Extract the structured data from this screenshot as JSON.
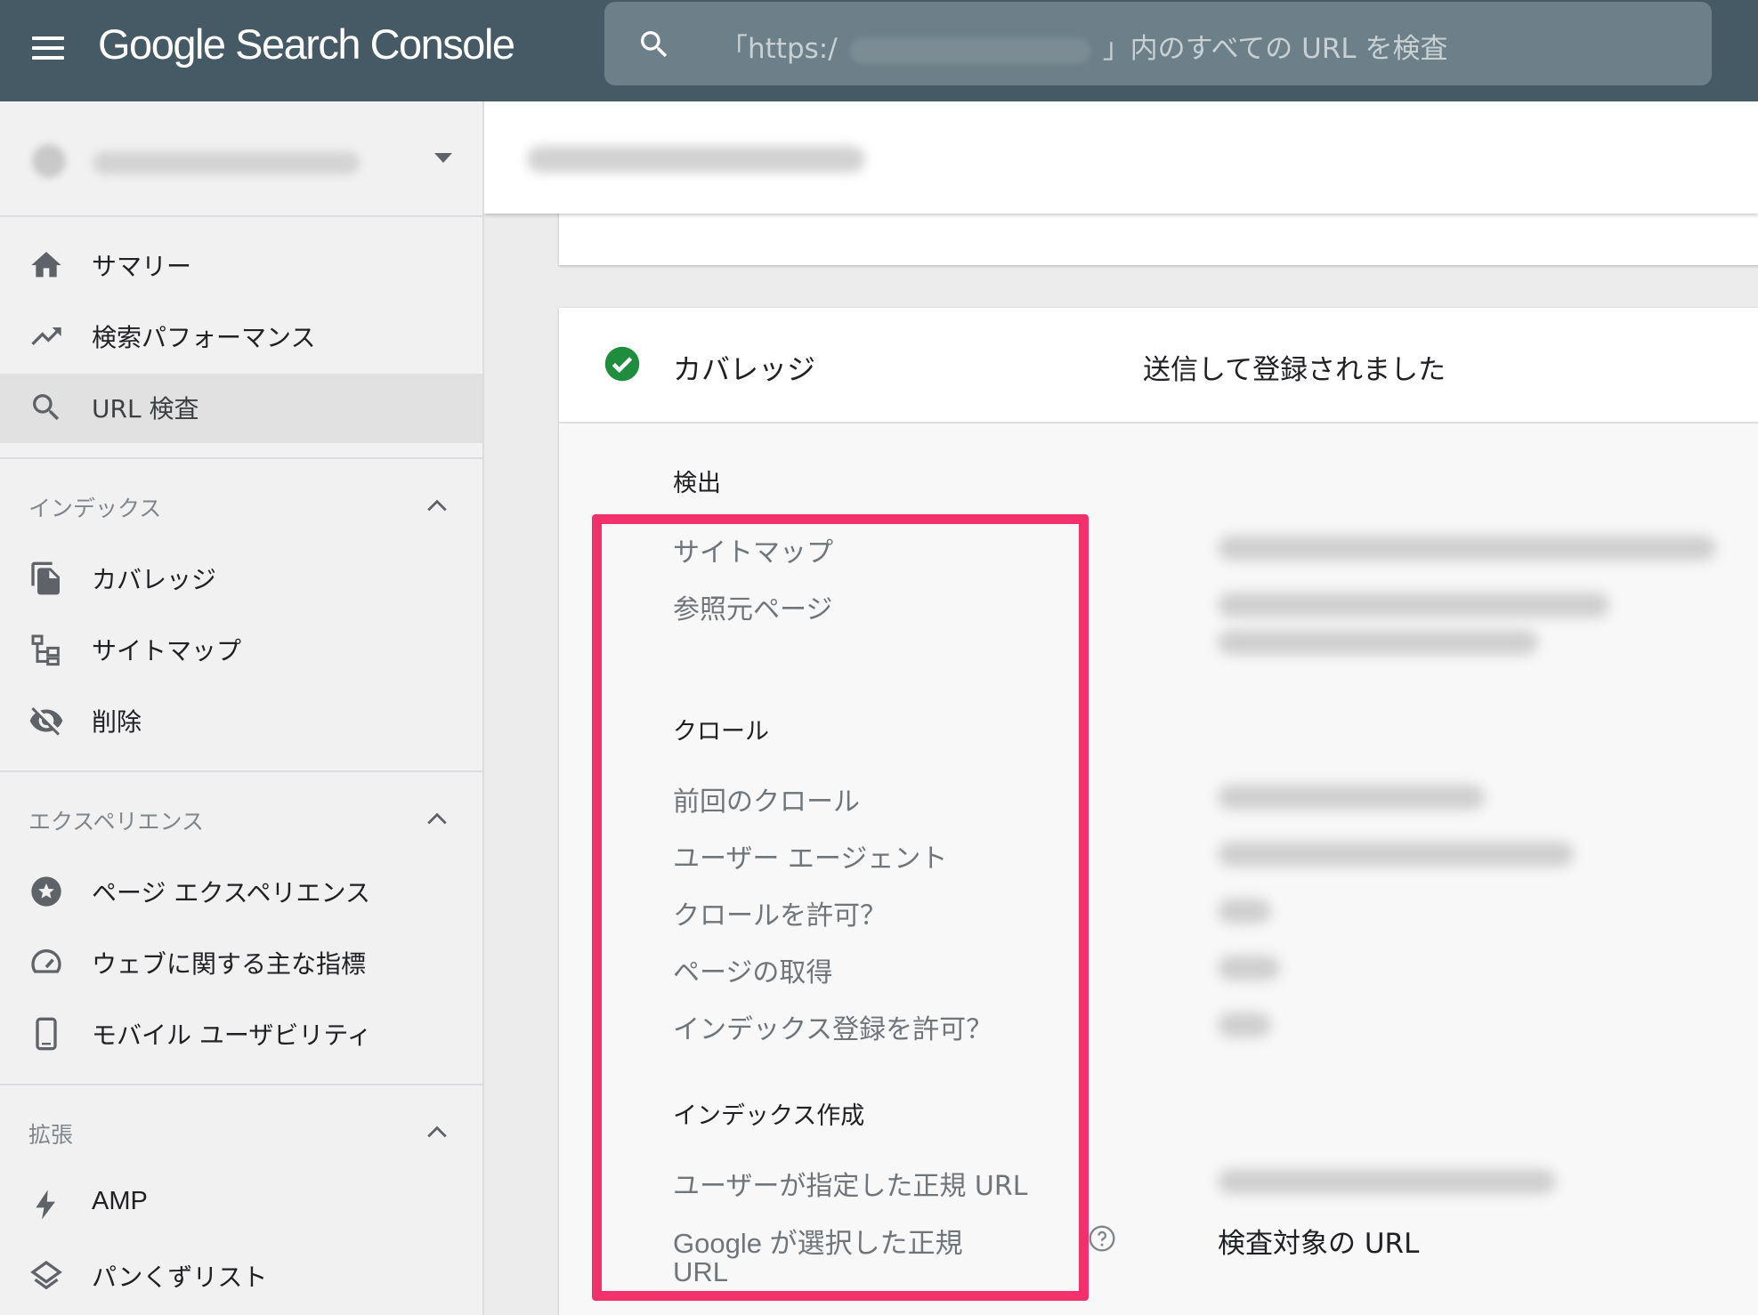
{
  "app": {
    "title": "Google Search Console"
  },
  "search": {
    "prefix": "「https:/",
    "suffix": "」内のすべての URL を検査"
  },
  "sidebar": {
    "items": [
      {
        "label": "サマリー"
      },
      {
        "label": "検索パフォーマンス"
      },
      {
        "label": "URL 検査"
      }
    ],
    "sections": [
      {
        "label": "インデックス",
        "items": [
          {
            "label": "カバレッジ"
          },
          {
            "label": "サイトマップ"
          },
          {
            "label": "削除"
          }
        ]
      },
      {
        "label": "エクスペリエンス",
        "items": [
          {
            "label": "ページ エクスペリエンス"
          },
          {
            "label": "ウェブに関する主な指標"
          },
          {
            "label": "モバイル ユーザビリティ"
          }
        ]
      },
      {
        "label": "拡張",
        "items": [
          {
            "label": "AMP"
          },
          {
            "label": "パンくずリスト"
          }
        ]
      }
    ]
  },
  "coverage": {
    "title": "カバレッジ",
    "status": "送信して登録されました",
    "groups": {
      "discovery": {
        "label": "検出",
        "rows": [
          {
            "label": "サイトマップ"
          },
          {
            "label": "参照元ページ"
          }
        ]
      },
      "crawl": {
        "label": "クロール",
        "rows": [
          {
            "label": "前回のクロール"
          },
          {
            "label": "ユーザー エージェント"
          },
          {
            "label": "クロールを許可？"
          },
          {
            "label": "ページの取得"
          },
          {
            "label": "インデックス登録を許可？"
          }
        ]
      },
      "indexing": {
        "label": "インデックス作成",
        "rows": [
          {
            "label": "ユーザーが指定した正規 URL"
          },
          {
            "label_line1": "Google が選択した正規",
            "label_line2": "URL",
            "value": "検査対象の URL"
          }
        ]
      }
    }
  },
  "colors": {
    "topbar": "#455a64",
    "highlight": "#f2306b",
    "check": "#1e8e3e",
    "active_nav": "#e1e1e1"
  }
}
